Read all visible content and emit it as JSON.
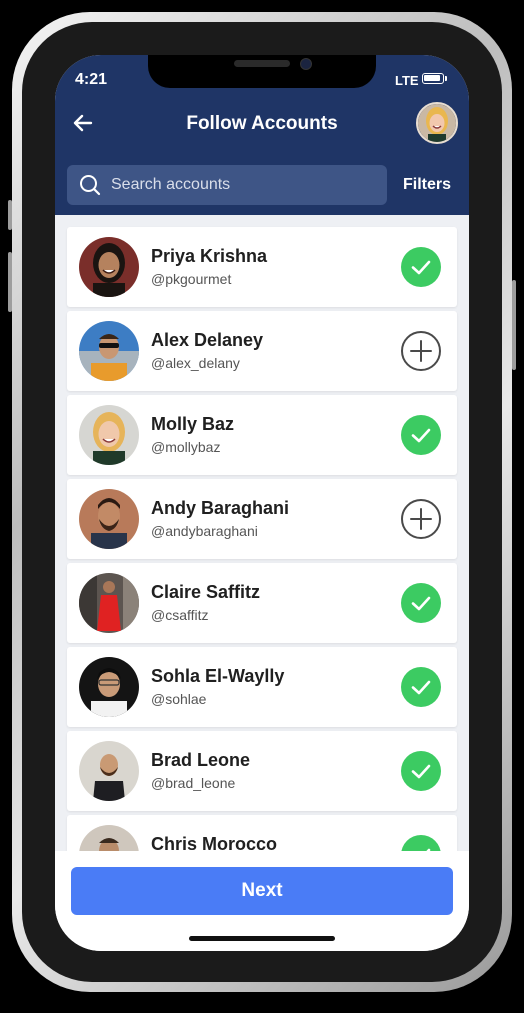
{
  "status_bar": {
    "time": "4:21",
    "network": "LTE"
  },
  "header": {
    "title": "Follow Accounts",
    "back_icon": "arrow-left-icon",
    "profile_avatar": "user-avatar"
  },
  "search": {
    "placeholder": "Search accounts",
    "value": "",
    "icon": "search-icon"
  },
  "filters_label": "Filters",
  "accounts": [
    {
      "name": "Priya Krishna",
      "handle": "@pkgourmet",
      "following": true
    },
    {
      "name": "Alex Delaney",
      "handle": "@alex_delany",
      "following": false
    },
    {
      "name": "Molly Baz",
      "handle": "@mollybaz",
      "following": true
    },
    {
      "name": "Andy Baraghani",
      "handle": "@andybaraghani",
      "following": false
    },
    {
      "name": "Claire Saffitz",
      "handle": "@csaffitz",
      "following": true
    },
    {
      "name": "Sohla El-Waylly",
      "handle": "@sohlae",
      "following": true
    },
    {
      "name": "Brad Leone",
      "handle": "@brad_leone",
      "following": true
    },
    {
      "name": "Chris Morocco",
      "handle": "",
      "following": true
    }
  ],
  "next_label": "Next",
  "colors": {
    "header": "#1f3566",
    "search_bg": "#3e5586",
    "followed": "#3ccb62",
    "primary_button": "#4a7cf6",
    "list_bg": "#eef0f4"
  }
}
